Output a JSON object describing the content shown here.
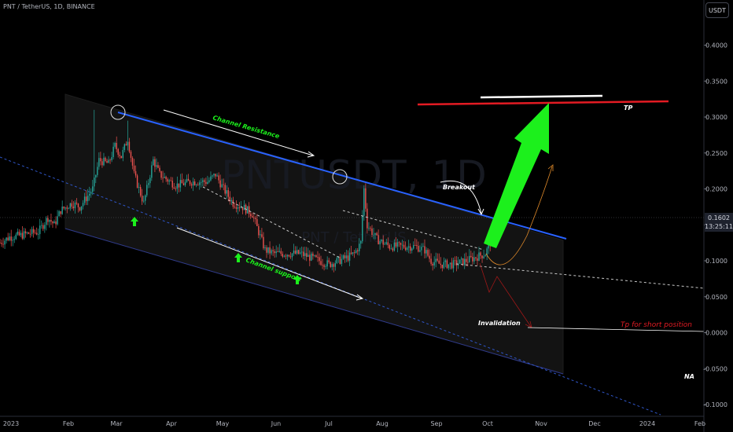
{
  "header": {
    "symbol_line": "PNT / TetherUS, 1D, BINANCE",
    "currency_button": "USDT",
    "current_price": "0.1602",
    "countdown": "13:25:11"
  },
  "watermark": {
    "main": "PNTUSDT, 1D",
    "sub": "PNT / TetherUS"
  },
  "colors": {
    "background": "#000000",
    "up_candle": "#26a69a",
    "down_candle": "#ef5350",
    "resistance_line": "#2962ff",
    "tp_line": "#e31b23",
    "arrow": "#1cf01c",
    "channel_fill": "#131313"
  },
  "chart_data": {
    "type": "candlestick",
    "pair": "PNT / TetherUS",
    "timeframe": "1D",
    "exchange": "BINANCE",
    "ylim": [
      -0.11,
      0.43
    ],
    "y_ticks": [
      0.4,
      0.35,
      0.3,
      0.25,
      0.2,
      0.15,
      0.1,
      0.05,
      0.0,
      -0.05,
      -0.1
    ],
    "y_tick_labels": [
      "0.4000",
      "0.3500",
      "0.3000",
      "0.2500",
      "0.2000",
      "0.1500",
      "0.1000",
      "0.0500",
      "0.0000",
      "-0.0500",
      "-0.1000"
    ],
    "x_ticks": [
      "2023",
      "Feb",
      "Mar",
      "Apr",
      "May",
      "Jun",
      "Jul",
      "Aug",
      "Sep",
      "Oct",
      "Nov",
      "Dec",
      "2024",
      "Feb"
    ],
    "price_path": [
      [
        0,
        0.125
      ],
      [
        6,
        0.133
      ],
      [
        12,
        0.135
      ],
      [
        18,
        0.138
      ],
      [
        24,
        0.14
      ],
      [
        30,
        0.16
      ],
      [
        34,
        0.15
      ],
      [
        38,
        0.17
      ],
      [
        45,
        0.18
      ],
      [
        50,
        0.175
      ],
      [
        58,
        0.2
      ],
      [
        62,
        0.24
      ],
      [
        68,
        0.235
      ],
      [
        72,
        0.26
      ],
      [
        76,
        0.245
      ],
      [
        80,
        0.27
      ],
      [
        84,
        0.22
      ],
      [
        90,
        0.18
      ],
      [
        96,
        0.24
      ],
      [
        100,
        0.22
      ],
      [
        110,
        0.205
      ],
      [
        120,
        0.21
      ],
      [
        130,
        0.21
      ],
      [
        135,
        0.22
      ],
      [
        140,
        0.2
      ],
      [
        146,
        0.18
      ],
      [
        152,
        0.175
      ],
      [
        158,
        0.165
      ],
      [
        162,
        0.14
      ],
      [
        166,
        0.115
      ],
      [
        172,
        0.11
      ],
      [
        180,
        0.11
      ],
      [
        188,
        0.11
      ],
      [
        194,
        0.105
      ],
      [
        200,
        0.1
      ],
      [
        206,
        0.095
      ],
      [
        212,
        0.1
      ],
      [
        218,
        0.105
      ],
      [
        222,
        0.11
      ],
      [
        226,
        0.125
      ],
      [
        228,
        0.2
      ],
      [
        230,
        0.15
      ],
      [
        236,
        0.13
      ],
      [
        244,
        0.12
      ],
      [
        252,
        0.12
      ],
      [
        260,
        0.12
      ],
      [
        266,
        0.115
      ],
      [
        270,
        0.1
      ],
      [
        276,
        0.095
      ],
      [
        284,
        0.095
      ],
      [
        292,
        0.1
      ],
      [
        298,
        0.105
      ],
      [
        304,
        0.11
      ],
      [
        308,
        0.13
      ],
      [
        312,
        0.16
      ],
      [
        315,
        0.175
      ],
      [
        317,
        0.16
      ]
    ],
    "price_path_x_ticks": [
      [
        0,
        "2023"
      ],
      [
        31,
        "Feb"
      ],
      [
        59,
        "Mar"
      ],
      [
        90,
        "Apr"
      ],
      [
        120,
        "May"
      ],
      [
        151,
        "Jun"
      ],
      [
        181,
        "Jul"
      ],
      [
        212,
        "Aug"
      ],
      [
        243,
        "Sep"
      ],
      [
        273,
        "Oct"
      ]
    ],
    "annotations": [
      "Channel Resistance",
      "Channel support",
      "Breakout",
      "TP",
      "Invalidation",
      "Tp for short position",
      "NA"
    ]
  }
}
